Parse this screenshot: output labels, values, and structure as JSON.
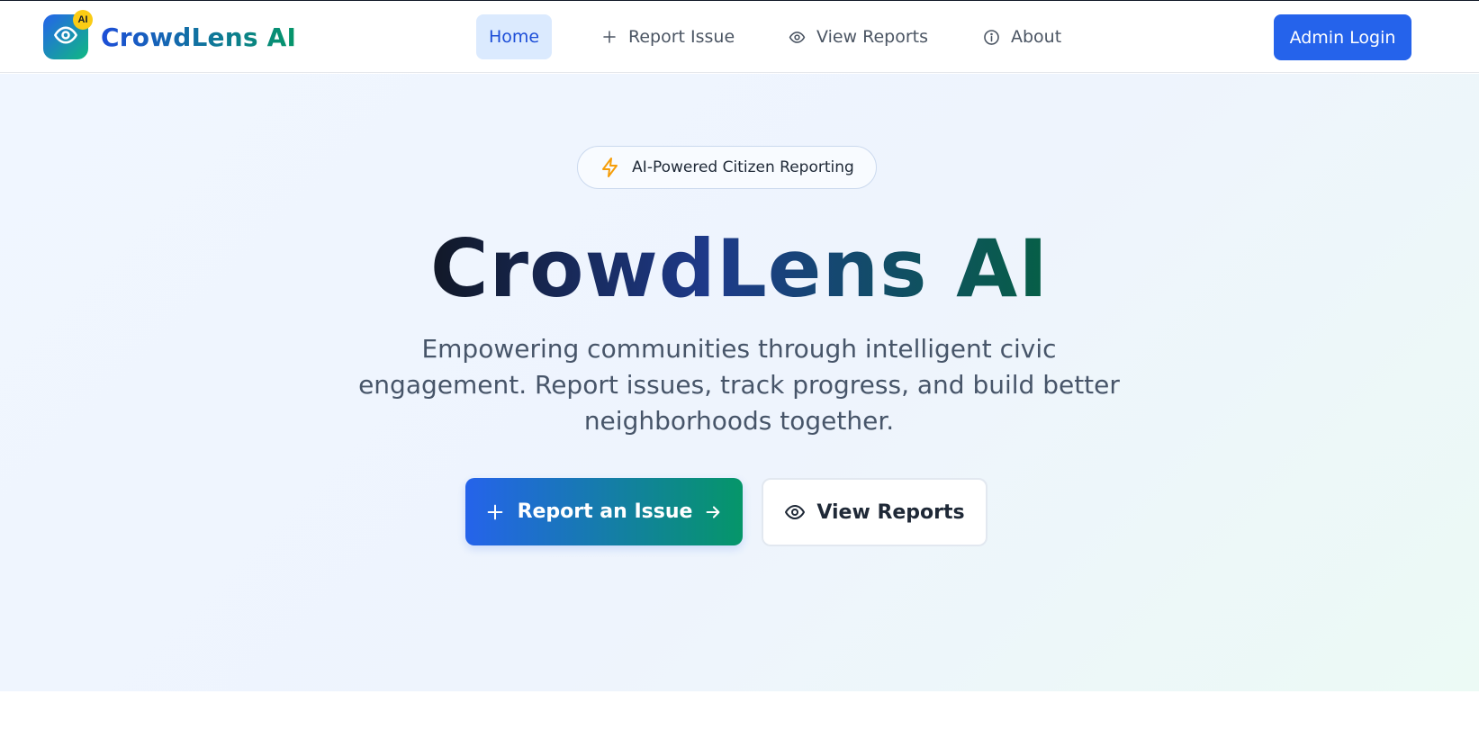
{
  "brand": {
    "name": "CrowdLens AI",
    "badge": "AI",
    "logo_icon": "eye-icon"
  },
  "nav": {
    "items": [
      {
        "label": "Home",
        "icon": null,
        "active": true
      },
      {
        "label": "Report Issue",
        "icon": "plus-icon"
      },
      {
        "label": "View Reports",
        "icon": "eye-icon"
      },
      {
        "label": "About",
        "icon": "info-icon"
      }
    ],
    "admin_label": "Admin Login"
  },
  "hero": {
    "pill_label": "AI-Powered Citizen Reporting",
    "pill_icon": "lightning-icon",
    "title": "CrowdLens AI",
    "subtitle": "Empowering communities through intelligent civic engagement. Report issues, track progress, and build better neighborhoods together.",
    "primary_button": "Report an Issue",
    "secondary_button": "View Reports"
  },
  "colors": {
    "accent": "#2563eb",
    "accent_green": "#059669",
    "badge_yellow": "#facc15",
    "lightning_orange": "#f59e0b",
    "nav_active_bg": "#dbeafe"
  }
}
